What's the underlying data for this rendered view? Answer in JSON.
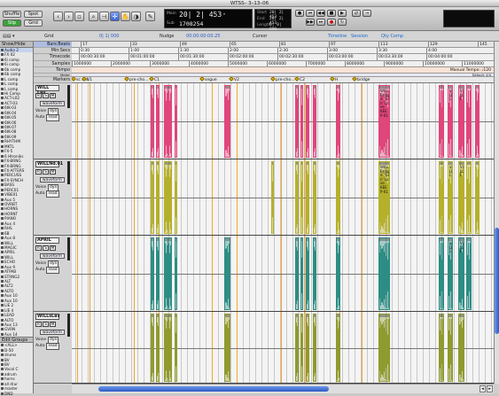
{
  "window": {
    "title": "WTSS– 3–13–06"
  },
  "toolbar": {
    "modes": [
      "Shuffle",
      "Spot",
      "Slip",
      "Grid"
    ],
    "counter": {
      "main_label": "Main",
      "sub_label": "Sub",
      "main_value": "20| 2| 453",
      "sub_value": "1708254",
      "start_label": "Start",
      "end_label": "End",
      "length_label": "Length",
      "start": "20| 2| 453",
      "end": "20| 2| 453",
      "length": "0| 0| 000"
    }
  },
  "strip": {
    "grid_label": "Grid",
    "grid_value": "0| 1| 000",
    "nudge_label": "Nudge",
    "nudge_value": "00:00:00:00.25",
    "cursor_label": "Cursor",
    "timeline_label": "Timeline",
    "session_label": "Session",
    "qty_label": "Qty Comp"
  },
  "left_pane": {
    "header": "Show/Hide",
    "items": [
      "Audio 2",
      "FX 02",
      "6i comp",
      "6i comp",
      "6b comp",
      "6b comp",
      "L comp",
      "L comp",
      "L comp",
      "Hi Comp",
      "ACT-L02",
      "ACT-03",
      "6tK-03",
      "6tK-04",
      "6tK-05",
      "6tK-06",
      "6tK-07",
      "6tK-08",
      "6tK-09",
      "RHYTHM",
      "MKTL",
      "FX-5",
      "6 Htroniks",
      "FX-BRNG",
      "FX-BRNG",
      "FX-AFTERS",
      "PERCUSS",
      "FX-SYNCH",
      "BASS",
      "PERC01",
      "VIBE01",
      "Aux 5",
      "OVRBT",
      "HORNS",
      "HORNT",
      "PIANO",
      "Aux 4",
      "RHS",
      "6B",
      "Aux 8",
      "WILL",
      "MAGIC",
      "APRIL",
      "WILL",
      "ECHO",
      "Aux 9",
      "ATPAB",
      "STRNG2",
      "ALT",
      "ALT2",
      "ALTO",
      "Aux 10",
      "Aux 10",
      "LIE 2",
      "LIE 4",
      "LEAD",
      "ALTO",
      "Aux 13",
      "GVRN",
      "Aux 14"
    ],
    "groups_header": "Edit Groups",
    "groups": [
      "<ALL>",
      "D-50",
      "drums",
      "BV",
      "BV",
      "Vocal C",
      "adrum",
      "horns",
      "all drur",
      "master",
      "DND"
    ]
  },
  "rulers": {
    "labels": [
      "Bars:Beats",
      "Min:Secs",
      "Timecode",
      "Samples",
      "Tempo",
      "Meter",
      "Markers"
    ],
    "bars": [
      "17",
      "33",
      "49",
      "65",
      "81",
      "97",
      "113",
      "129",
      "145"
    ],
    "minsecs": [
      "0:30",
      "1:00",
      "1:30",
      "2:00",
      "2:30",
      "3:00",
      "3:30",
      "4:00"
    ],
    "timecode": [
      "00:00:30:00",
      "00:01:00:00",
      "00:01:30:00",
      "00:02:00:00",
      "00:02:30:00",
      "00:03:00:00",
      "00:03:30:00",
      "00:04:00:00"
    ],
    "samples": [
      "1000000",
      "2000000",
      "3000000",
      "4000000",
      "5000000",
      "6000000",
      "7000000",
      "8000000",
      "9000000",
      "10000000",
      "11000000"
    ],
    "tempo_text": "Manual Tempo: ♩120",
    "meter_text": "Default: 4/4",
    "markers": [
      "sc ent.",
      "V1",
      "pre-cho…",
      "C1",
      "segue",
      "V2",
      "pre-cho…",
      "C2",
      "H",
      "bridge"
    ]
  },
  "tracks": [
    {
      "name": "WILL Lav",
      "view": "waveform",
      "voice_label": "Voice",
      "voice_value": "dyn",
      "auto_label": "Auto",
      "auto_value": "read",
      "color": "#e0457b"
    },
    {
      "name": "WILLNd.01",
      "view": "waveform",
      "voice_label": "Voice",
      "voice_value": "dyn",
      "auto_label": "Auto",
      "auto_value": "read",
      "color": "#b5b02a"
    },
    {
      "name": "APRIL",
      "view": "waveform",
      "voice_label": "Voice",
      "voice_value": "dyn",
      "auto_label": "Auto",
      "auto_value": "read",
      "color": "#2d8d84"
    },
    {
      "name": "WILLsLav",
      "view": "waveform",
      "voice_label": "Voice",
      "voice_value": "dyn",
      "auto_label": "Auto",
      "auto_value": "read",
      "color": "#8f9a2f"
    }
  ],
  "clip_text": {
    "will_bridge": "WILL\nBridg\ne \"Gi\nn' Lo\nve\nKEE\nP-01",
    "willnd_bridge": "WILL\nBridg\ne \"Gi\nn' Lo\nve\nKEE\nP-01",
    "vi": "VI\nLL\nL"
  }
}
